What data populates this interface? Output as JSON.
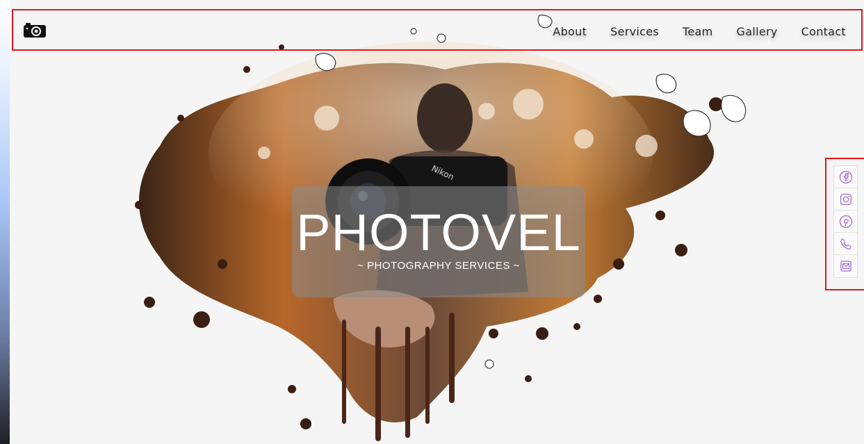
{
  "brand": {
    "logo_icon": "camera-icon"
  },
  "nav": {
    "items": [
      {
        "label": "About"
      },
      {
        "label": "Services"
      },
      {
        "label": "Team"
      },
      {
        "label": "Gallery"
      },
      {
        "label": "Contact"
      }
    ]
  },
  "hero": {
    "title": "PHOTOVEL",
    "subtitle": "~ PHOTOGRAPHY SERVICES ~",
    "image_icon": "photographer-holding-camera-image"
  },
  "social": {
    "items": [
      {
        "icon": "facebook-icon"
      },
      {
        "icon": "instagram-icon"
      },
      {
        "icon": "pinterest-icon"
      },
      {
        "icon": "phone-icon"
      },
      {
        "icon": "mail-icon"
      }
    ],
    "icon_color": "#a46bd8"
  },
  "colors": {
    "highlight_border": "#e3141a",
    "nav_text": "#222222",
    "title_text": "#ffffff"
  }
}
